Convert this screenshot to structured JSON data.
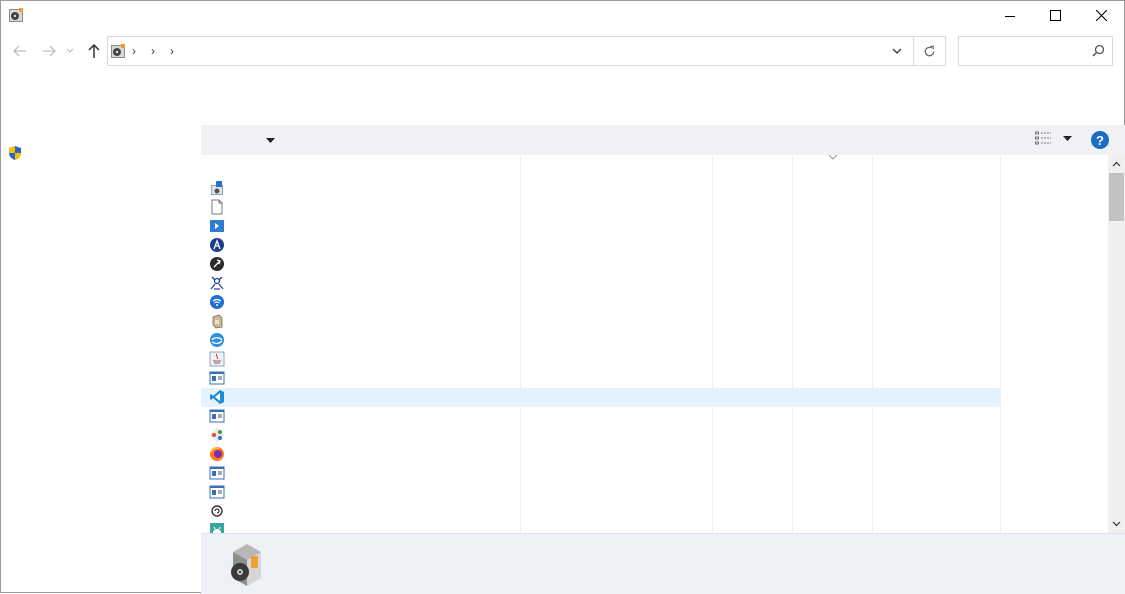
{
  "window": {
    "title": "",
    "icon": "programs-features-icon",
    "controls": {
      "minimize": "minimize-icon",
      "maximize": "maximize-icon",
      "close": "close-icon"
    }
  },
  "nav": {
    "back": "arrow-left-icon",
    "forward": "arrow-right-icon",
    "recent": "chevron-down-icon",
    "up": "arrow-up-icon"
  },
  "address": {
    "crumbs": [
      "›",
      "›",
      "›"
    ],
    "dropdown": "chevron-down-icon",
    "refresh": "refresh-icon"
  },
  "search": {
    "placeholder": "",
    "icon": "search-icon"
  },
  "sidebar": {
    "items": [
      {
        "icon": "uac-shield-icon",
        "label": ""
      }
    ]
  },
  "toolbar": {
    "organize_dropdown": "chevron-down-icon",
    "view_icon": "details-view-icon",
    "help": "?"
  },
  "list": {
    "sort_indicator": "chevron-down-icon",
    "rows": [
      {
        "icon": "installer-icon",
        "selected": false
      },
      {
        "icon": "blank-document-icon",
        "selected": false
      },
      {
        "icon": "blue-app-icon",
        "selected": false
      },
      {
        "icon": "blue-a-icon",
        "selected": false
      },
      {
        "icon": "dark-circle-icon",
        "selected": false
      },
      {
        "icon": "network-bug-icon",
        "selected": false
      },
      {
        "icon": "wifi-circle-icon",
        "selected": false
      },
      {
        "icon": "box-icon",
        "selected": false
      },
      {
        "icon": "blue-swirl-icon",
        "selected": false
      },
      {
        "icon": "java-icon",
        "selected": false
      },
      {
        "icon": "window-app-icon",
        "selected": false
      },
      {
        "icon": "vscode-icon",
        "selected": true
      },
      {
        "icon": "window-app-icon",
        "selected": false
      },
      {
        "icon": "git-icon",
        "selected": false
      },
      {
        "icon": "firefox-icon",
        "selected": false
      },
      {
        "icon": "window-app-icon",
        "selected": false
      },
      {
        "icon": "window-app-icon",
        "selected": false
      },
      {
        "icon": "small-circle-icon",
        "selected": false
      },
      {
        "icon": "android-icon",
        "selected": false
      }
    ]
  },
  "details_pane": {
    "icon": "programs-features-large-icon"
  },
  "colors": {
    "selected_row": "#e5f3ff",
    "toolbar_bg": "#f0f2f5",
    "help_blue": "#1a6dc2"
  }
}
